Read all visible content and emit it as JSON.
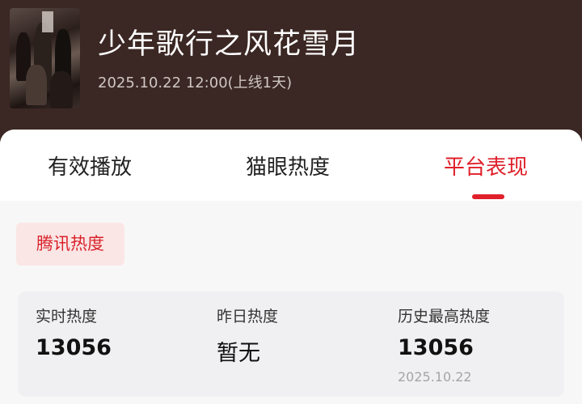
{
  "header": {
    "title": "少年歌行之风花雪月",
    "subtitle": "2025.10.22 12:00(上线1天)"
  },
  "tabs": [
    {
      "label": "有效播放",
      "active": false
    },
    {
      "label": "猫眼热度",
      "active": false
    },
    {
      "label": "平台表现",
      "active": true
    }
  ],
  "badge": {
    "label": "腾讯热度"
  },
  "stats": [
    {
      "label": "实时热度",
      "value": "13056"
    },
    {
      "label": "昨日热度",
      "value": "暂无"
    },
    {
      "label": "历史最高热度",
      "value": "13056",
      "date": "2025.10.22"
    }
  ],
  "colors": {
    "header_bg": "#3b2723",
    "accent": "#e0202a",
    "badge_bg": "#fbe6e6",
    "card_bg": "#f7f7f8"
  }
}
